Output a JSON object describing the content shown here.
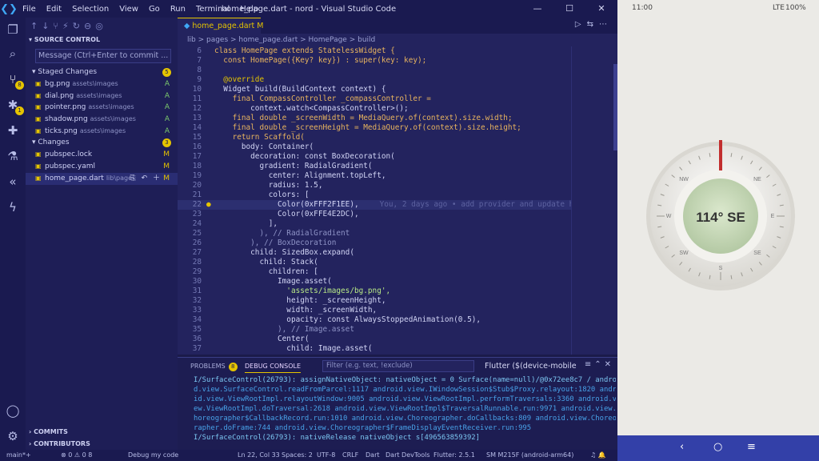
{
  "titlebar": {
    "menu": [
      "File",
      "Edit",
      "Selection",
      "View",
      "Go",
      "Run",
      "Terminal",
      "Help"
    ],
    "title": "home_page.dart - nord - Visual Studio Code",
    "minimize": "—",
    "maximize": "☐",
    "close": "✕"
  },
  "activity": {
    "scm_badge": "8",
    "debug_badge": "1"
  },
  "sidebar": {
    "section": "SOURCE CONTROL",
    "message_placeholder": "Message (Ctrl+Enter to commit ...",
    "staged_label": "Staged Changes",
    "staged_count": "5",
    "staged": [
      {
        "name": "bg.png",
        "path": "assets\\images",
        "status": "A"
      },
      {
        "name": "dial.png",
        "path": "assets\\images",
        "status": "A"
      },
      {
        "name": "pointer.png",
        "path": "assets\\images",
        "status": "A"
      },
      {
        "name": "shadow.png",
        "path": "assets\\images",
        "status": "A"
      },
      {
        "name": "ticks.png",
        "path": "assets\\images",
        "status": "A"
      }
    ],
    "changes_label": "Changes",
    "changes_count": "3",
    "changes": [
      {
        "name": "pubspec.lock",
        "path": "",
        "status": "M"
      },
      {
        "name": "pubspec.yaml",
        "path": "",
        "status": "M"
      },
      {
        "name": "home_page.dart",
        "path": "lib\\pages",
        "status": "M"
      }
    ],
    "commits": "COMMITS",
    "contributors": "CONTRIBUTORS"
  },
  "editor": {
    "tab": "home_page.dart",
    "tab_status": "M",
    "breadcrumb": "lib  >  pages  >  home_page.dart  >  HomePage  >  build",
    "lines": [
      {
        "n": "6",
        "t": "class HomePage extends StatelessWidget {"
      },
      {
        "n": "7",
        "t": "  const HomePage({Key? key}) : super(key: key);"
      },
      {
        "n": "8",
        "t": ""
      },
      {
        "n": "9",
        "t": "  @override"
      },
      {
        "n": "10",
        "t": "  Widget build(BuildContext context) {"
      },
      {
        "n": "11",
        "t": "    final CompassController _compassController ="
      },
      {
        "n": "12",
        "t": "        context.watch<CompassController>();"
      },
      {
        "n": "13",
        "t": "    final double _screenWidth = MediaQuery.of(context).size.width;"
      },
      {
        "n": "14",
        "t": "    final double _screenHeight = MediaQuery.of(context).size.height;"
      },
      {
        "n": "15",
        "t": "    return Scaffold("
      },
      {
        "n": "16",
        "t": "      body: Container("
      },
      {
        "n": "17",
        "t": "        decoration: const BoxDecoration("
      },
      {
        "n": "18",
        "t": "          gradient: RadialGradient("
      },
      {
        "n": "19",
        "t": "            center: Alignment.topLeft,"
      },
      {
        "n": "20",
        "t": "            radius: 1.5,"
      },
      {
        "n": "21",
        "t": "            colors: ["
      },
      {
        "n": "22",
        "t": "              Color(0xFFF2F1EE),"
      },
      {
        "n": "23",
        "t": "              Color(0xFFE4E2DC),"
      },
      {
        "n": "24",
        "t": "            ],"
      },
      {
        "n": "25",
        "t": "          ), // RadialGradient"
      },
      {
        "n": "26",
        "t": "        ), // BoxDecoration"
      },
      {
        "n": "27",
        "t": "        child: SizedBox.expand("
      },
      {
        "n": "28",
        "t": "          child: Stack("
      },
      {
        "n": "29",
        "t": "            children: ["
      },
      {
        "n": "30",
        "t": "              Image.asset("
      },
      {
        "n": "31",
        "t": "                'assets/images/bg.png',"
      },
      {
        "n": "32",
        "t": "                height: _screenHeight,"
      },
      {
        "n": "33",
        "t": "                width: _screenWidth,"
      },
      {
        "n": "34",
        "t": "                opacity: const AlwaysStoppedAnimation(0.5),"
      },
      {
        "n": "35",
        "t": "              ), // Image.asset"
      },
      {
        "n": "36",
        "t": "              Center("
      },
      {
        "n": "37",
        "t": "                child: Image.asset("
      }
    ],
    "blame": "You, 2 days ago • add provider and update homepa"
  },
  "panel": {
    "problems": "PROBLEMS",
    "problems_count": "8",
    "debug": "DEBUG CONSOLE",
    "filter_placeholder": "Filter (e.g. text, !exclude)",
    "device": "Flutter ($(device-mobile",
    "log": [
      "I/SurfaceControl(26793): assignNativeObject: nativeObject = 0 Surface(name=null)/@0x72ee8c7 / androi",
      "d.view.SurfaceControl.readFromParcel:1117 android.view.IWindowSession$Stub$Proxy.relayout:1820 andro",
      "id.view.ViewRootImpl.relayoutWindow:9005 android.view.ViewRootImpl.performTraversals:3360 android.vi",
      "ew.ViewRootImpl.doTraversal:2618 android.view.ViewRootImpl$TraversalRunnable.run:9971 android.view.C",
      "horeographer$CallbackRecord.run:1010 android.view.Choreographer.doCallbacks:809 android.view.Choreog",
      "rapher.doFrame:744 android.view.Choreographer$FrameDisplayEventReceiver.run:995",
      "I/SurfaceControl(26793): nativeRelease nativeObject s[496563859392]"
    ]
  },
  "status": {
    "branch": "main*+",
    "errors": "⊗ 0 ⚠ 0  8",
    "debug": "Debug my code",
    "pos": "Ln 22, Col 33",
    "spaces": "Spaces: 2",
    "enc": "UTF-8",
    "eol": "CRLF",
    "lang": "Dart",
    "devtools": "Dart DevTools",
    "flutter": "Flutter: 2.5.1",
    "device": "SM M215F (android-arm64)"
  },
  "phone": {
    "time": "11:00",
    "network": "LTE",
    "battery": "100%",
    "heading": "114° SE",
    "dial_labels": [
      "N",
      "NE",
      "E",
      "SE",
      "S",
      "SW",
      "W",
      "NW"
    ],
    "nav": [
      "‹",
      "○",
      "≡"
    ]
  }
}
